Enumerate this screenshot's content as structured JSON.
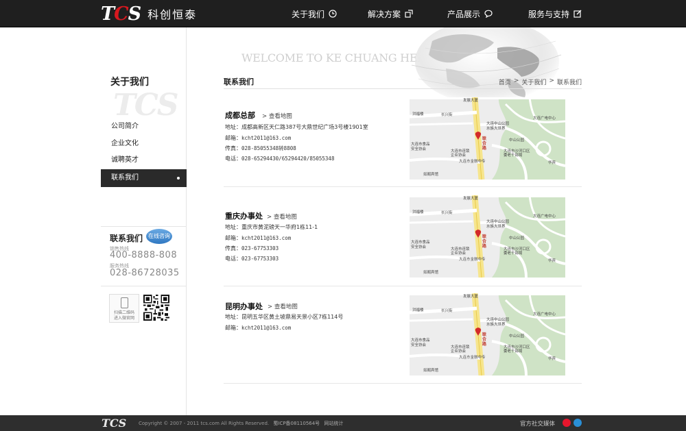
{
  "header": {
    "logo_text": "TCS",
    "logo_cn": "科创恒泰",
    "nav": [
      {
        "label": "关于我们",
        "icon": "clock-icon"
      },
      {
        "label": "解决方案",
        "icon": "external-window-icon"
      },
      {
        "label": "产品展示",
        "icon": "speech-bubble-icon"
      },
      {
        "label": "服务与支持",
        "icon": "edit-square-icon"
      }
    ]
  },
  "banner": {
    "text": "WELCOME TO KE CHUANG HENG TAI"
  },
  "sidebar": {
    "title": "关于我们",
    "watermark": "TCS",
    "items": [
      {
        "label": "公司简介"
      },
      {
        "label": "企业文化"
      },
      {
        "label": "诚聘英才"
      },
      {
        "label": "联系我们",
        "active": true
      }
    ],
    "contact": {
      "title": "联系我们",
      "chat_label": "在线咨询",
      "sales_label": "销售热线",
      "sales_number": "400-8888-808",
      "service_label": "服务热线",
      "service_number": "028-86728035"
    },
    "qr_caption_1": "扫描二维码",
    "qr_caption_2": "进入微官网"
  },
  "main": {
    "title": "联系我们",
    "breadcrumb": [
      "首页",
      ">",
      "关于我们",
      ">",
      "联系我们"
    ],
    "offices": [
      {
        "name": "成都总部",
        "map_link": "> 查看地图",
        "lines": [
          {
            "label": "地址：",
            "value": "成都高新区天仁路387号大鼎世纪广场3号楼1901室"
          },
          {
            "label": "邮箱：",
            "value": "kcht2011@163.com"
          },
          {
            "label": "传真：",
            "value": "028-85055348转8808"
          },
          {
            "label": "电话：",
            "value": "028-65294430/65294420/85055348"
          }
        ]
      },
      {
        "name": "重庆办事处",
        "map_link": "> 查看地图",
        "lines": [
          {
            "label": "地址：",
            "value": "重庆市黄泥磅天一华府1栋11-1"
          },
          {
            "label": "邮箱：",
            "value": "kcht2011@163.com"
          },
          {
            "label": "传真：",
            "value": "023-67753303"
          },
          {
            "label": "电话：",
            "value": "023-67753303"
          }
        ]
      },
      {
        "name": "昆明办事处",
        "map_link": "> 查看地图",
        "lines": [
          {
            "label": "地址：",
            "value": "昆明五华区黄土坡鼎易天景小区7栋114号"
          },
          {
            "label": "邮箱：",
            "value": "kcht2011@163.com"
          }
        ]
      }
    ],
    "map_labels": [
      "发展大厦",
      "洪福楼",
      "长兴街",
      "大连中山公园",
      "水族大世界",
      "大连广电中心",
      "中山公园",
      "大连市食品安全协会",
      "大连市连锁企业协会",
      "大连市沙河口区委老干部局",
      "大连市金融中专",
      "联合路",
      "华宾",
      "如阁宾馆"
    ]
  },
  "footer": {
    "logo_text": "TCS",
    "copyright": "Copyright © 2007 - 2011 tcs.com All Rights Reserved.",
    "icp": "蜀ICP备08110564号",
    "stats": "网站统计",
    "social_label": "官方社交媒体",
    "colors": {
      "weibo": "#e6162d",
      "qq": "#2a8fd6"
    }
  }
}
